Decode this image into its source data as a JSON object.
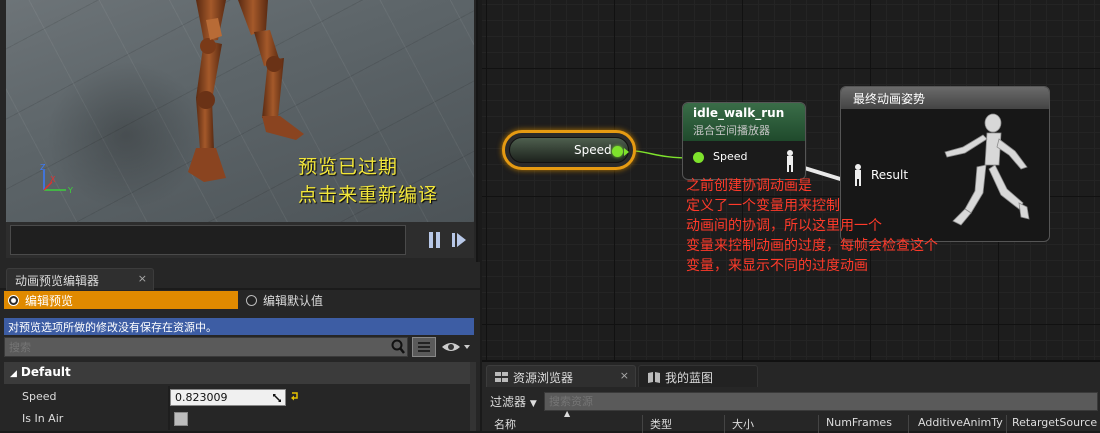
{
  "viewport": {
    "overlay_line1": "预览已过期",
    "overlay_line2": "点击来重新编译",
    "axis": {
      "z": "Z",
      "x": "X",
      "y": "Y"
    }
  },
  "details": {
    "tab_label": "动画预览编辑器",
    "tab_close": "×",
    "radio_edit_preview": "编辑预览",
    "radio_edit_defaults": "编辑默认值",
    "notice": "对预览选项所做的修改没有保存在资源中。",
    "search_placeholder": "搜索",
    "section_title": "Default",
    "section_toggle": "◢",
    "properties": {
      "speed_label": "Speed",
      "speed_value": "0.823009",
      "in_air_label": "Is In Air",
      "in_air_checked": false
    }
  },
  "graph": {
    "speed_node_label": "Speed",
    "blend_node_title": "idle_walk_run",
    "blend_node_subtitle": "混合空间播放器",
    "blend_pin_label": "Speed",
    "result_node_title": "最终动画姿势",
    "result_pin_label": "Result",
    "annotation": "之前创建协调动画是\n定义了一个变量用来控制\n动画间的协调，所以这里用一个\n变量来控制动画的过度，每帧会检查这个\n变量，来显示不同的过度动画",
    "pin_color": "#7ee22c",
    "selection_color": "#e59a12"
  },
  "browser": {
    "tab_assets": "资源浏览器",
    "tab_blueprint": "我的蓝图",
    "filter_label": "过滤器",
    "search_placeholder": "搜索资源",
    "columns": [
      "名称",
      "类型",
      "大小",
      "NumFrames",
      "AdditiveAnimTy",
      "RetargetSource"
    ]
  }
}
